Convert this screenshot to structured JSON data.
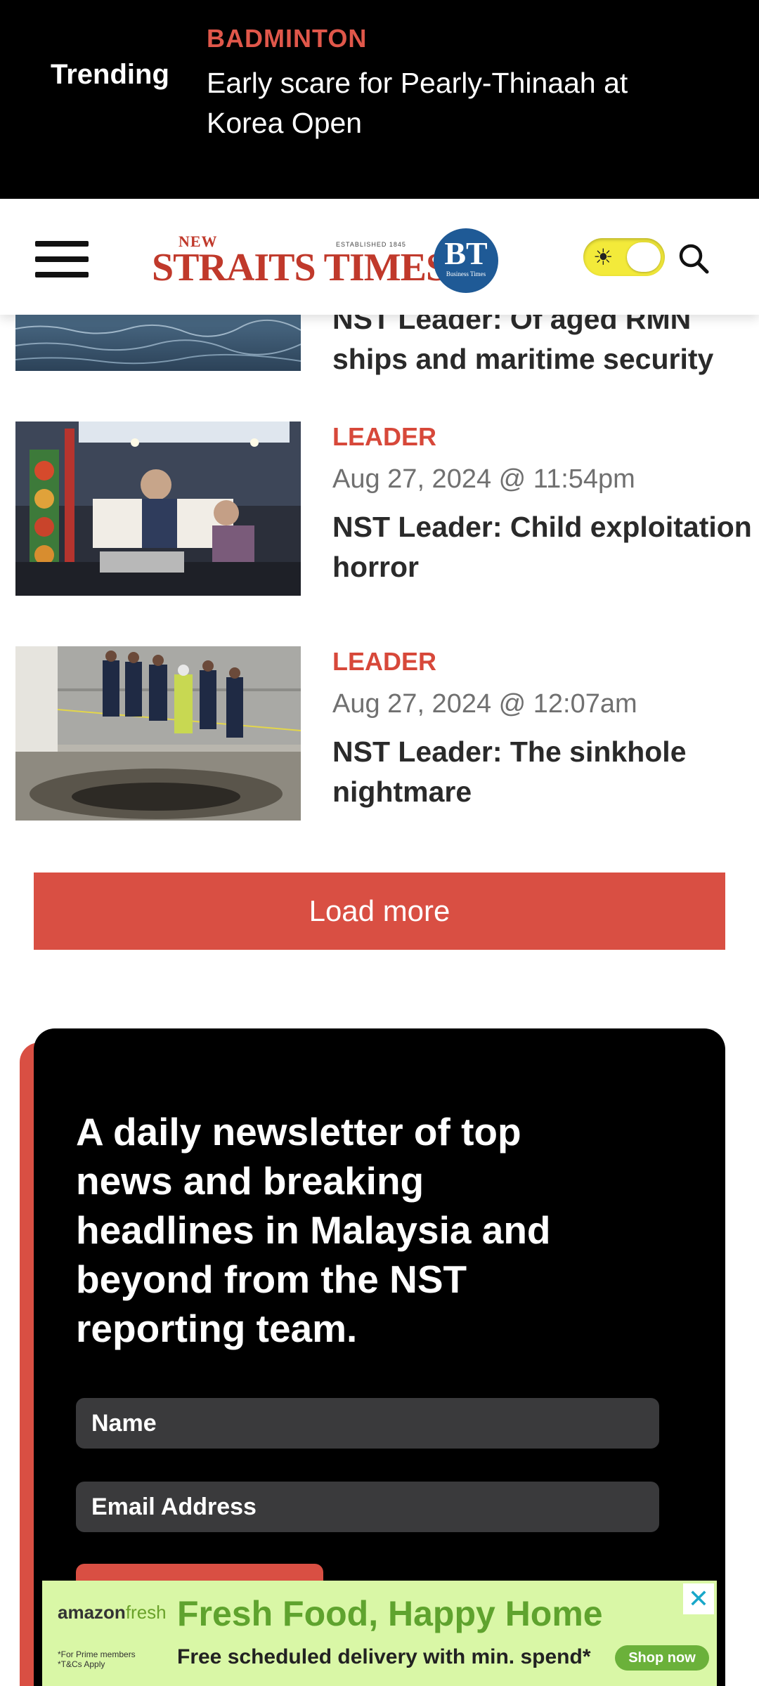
{
  "trending": {
    "label": "Trending",
    "category": "BADMINTON",
    "headline": "Early scare for Pearly-Thinaah at Korea Open"
  },
  "header": {
    "logo_new": "NEW",
    "logo_established": "ESTABLISHED 1845",
    "logo_main": "STRAITS TIMES",
    "logo_bt": "BT",
    "logo_bt_sub": "Business Times",
    "theme_toggle_state": "light"
  },
  "articles": [
    {
      "title": "NST Leader: Of aged RMN ships and maritime security"
    },
    {
      "category": "LEADER",
      "date": "Aug 27, 2024 @ 11:54pm",
      "title": "NST Leader: Child exploitation horror"
    },
    {
      "category": "LEADER",
      "date": "Aug 27, 2024 @ 12:07am",
      "title": "NST Leader: The sinkhole nightmare"
    }
  ],
  "load_more": "Load more",
  "newsletter": {
    "text": "A daily newsletter of top news and breaking headlines in Malaysia and beyond from the NST reporting team.",
    "name_placeholder": "Name",
    "email_placeholder": "Email Address"
  },
  "ad": {
    "brand_prefix": "amazon",
    "brand_suffix": "fresh",
    "headline": "Fresh Food, Happy Home",
    "subline": "Free scheduled delivery with min. spend*",
    "fine_print": "*For Prime members *T&Cs Apply",
    "cta": "Shop now",
    "close": "✕"
  },
  "colors": {
    "accent": "#d94f43",
    "trending_category": "#e0574a",
    "logo_red": "#c0392b",
    "bt_blue": "#1f5a96",
    "toggle_yellow": "#f3ea3a",
    "ad_background": "#d9f7a6",
    "ad_green": "#5fa32e"
  }
}
